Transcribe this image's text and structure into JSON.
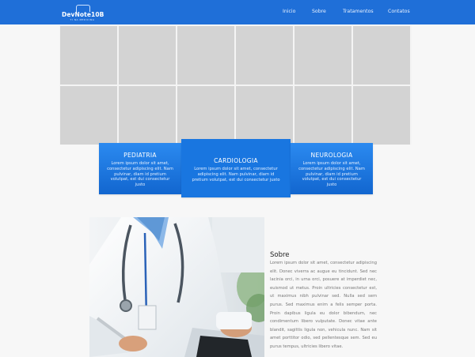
{
  "header": {
    "brand": "DevNote10B",
    "tagline": "TI NA MEDICINA",
    "nav": [
      {
        "label": "Inicio"
      },
      {
        "label": "Sobre"
      },
      {
        "label": "Tratamentos"
      },
      {
        "label": "Contatos"
      }
    ]
  },
  "specialties": [
    {
      "title": "PEDIATRIA",
      "text": "Lorem ipsum dolor sit amet, consectetur adipiscing elit. Nam pulvinar, diam id pretium volutpat, est dui consectetur justo"
    },
    {
      "title": "CARDIOLOGIA",
      "text": "Lorem ipsum dolor sit amet, consectetur adipiscing elit. Nam pulvinar, diam id pretium volutpat, est dui consectetur justo"
    },
    {
      "title": "NEUROLOGIA",
      "text": "Lorem ipsum dolor sit amet, consectetur adipiscing elit. Nam pulvinar, diam id pretium volutpat, est dui consectetur justo"
    }
  ],
  "about": {
    "title": "Sobre",
    "text": "Lorem ipsum dolor sit amet, consectetur adipiscing elit. Donec viverra ac augue eu tincidunt. Sed nec lacinia orci, in urna orci, posuere at imperdiet nec, euismod ut metus. Proin ultricies consectetur est, ut maximus nibh pulvinar sed. Nulla sed sem purus. Sed maximus enim a felis semper porta. Proin dapibus ligula eu dolor bibendum, nec condimentum libero vulputate. Donec vitae ante blandit, sagittis ligula non, vehicula nunc. Nam sit amet porttitor odio, sed pellentesque sem. Sed eu purus tempus, ultricies libero vitae."
  },
  "colors": {
    "header": "#1f6fd8",
    "card": "#1976e0",
    "placeholder": "#d3d3d3"
  }
}
